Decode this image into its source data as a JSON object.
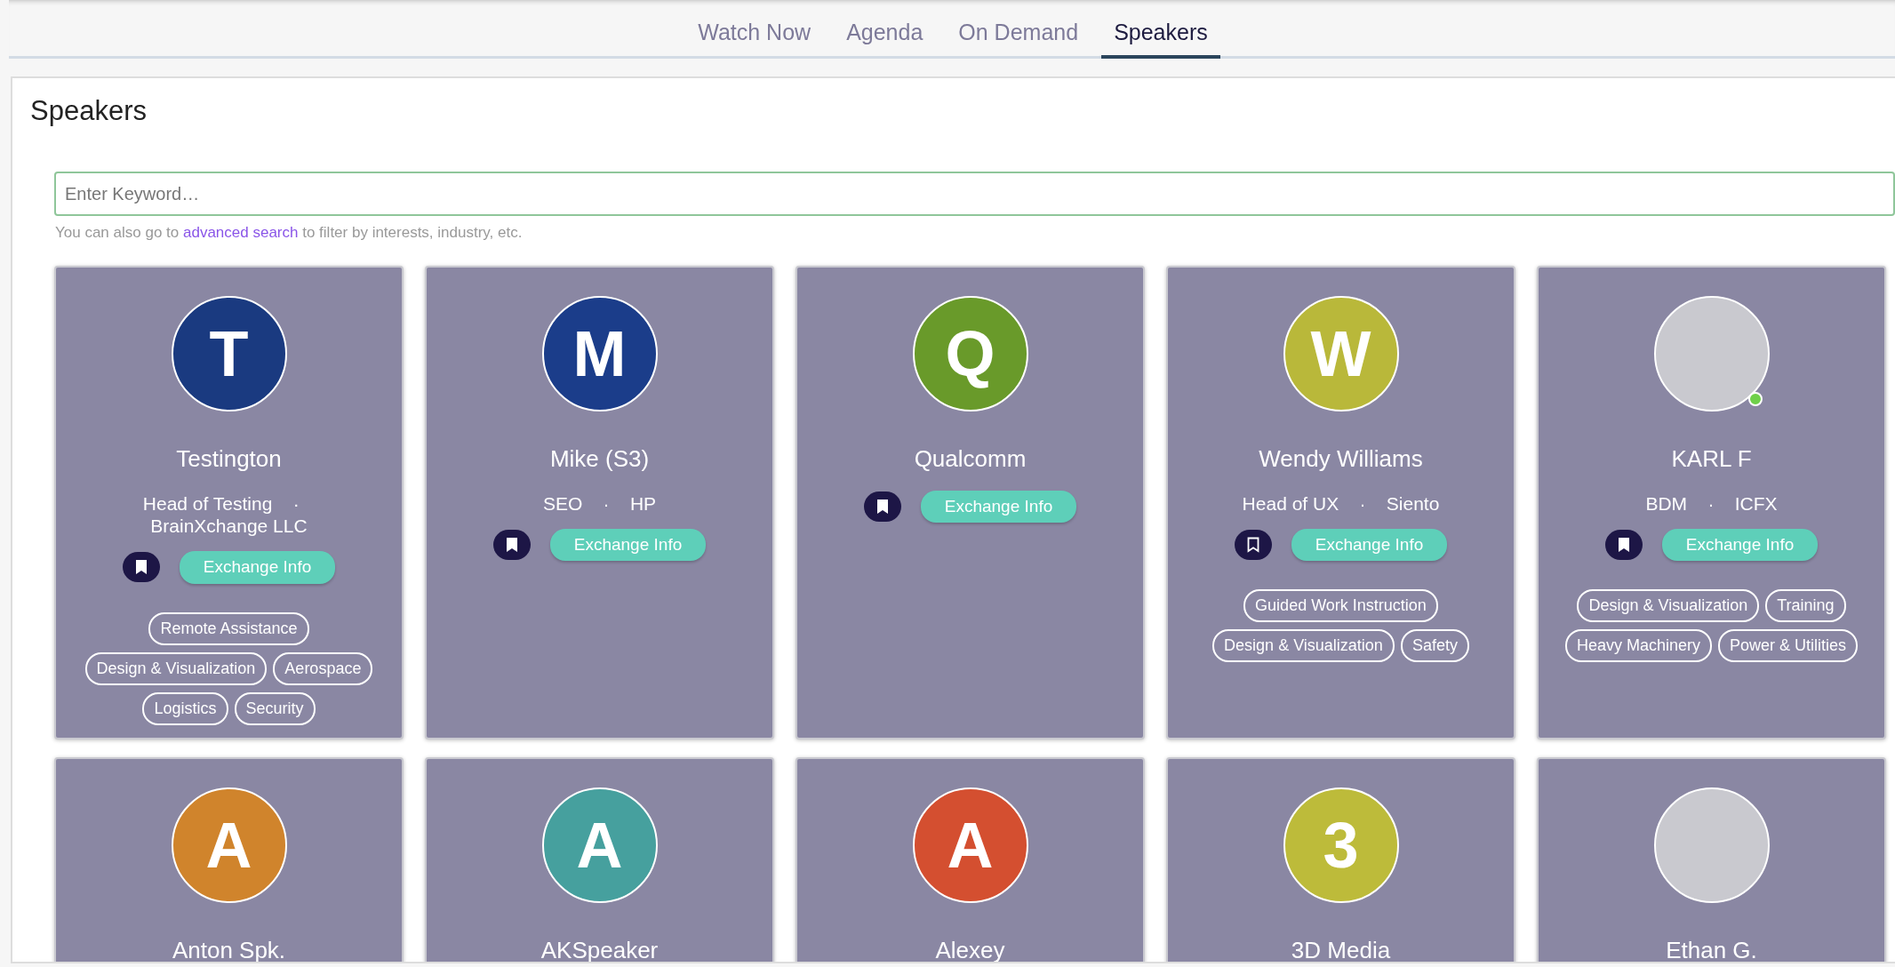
{
  "tabs": [
    {
      "label": "Watch Now",
      "selected": false
    },
    {
      "label": "Agenda",
      "selected": false
    },
    {
      "label": "On Demand",
      "selected": false
    },
    {
      "label": "Speakers",
      "selected": true
    }
  ],
  "panel": {
    "title": "Speakers",
    "search": {
      "placeholder": "Enter Keyword…"
    },
    "hint": {
      "before": "You can also go to",
      "link": "advanced search",
      "after": "to filter by interests, industry, etc."
    }
  },
  "speakers": [
    {
      "kind": "initial",
      "initial": "T",
      "color": "#1a3a80",
      "name": "Testington",
      "title": "Head of Testing",
      "separator": "·",
      "company": "BrainXchange LLC",
      "bookmarked": true,
      "button": "Exchange Info",
      "online": false,
      "tags": [
        "Remote Assistance",
        "Design & Visualization",
        "Aerospace",
        "Logistics",
        "Security"
      ]
    },
    {
      "kind": "initial",
      "initial": "M",
      "color": "#1b3d8a",
      "name": "Mike (S3)",
      "title": "SEO",
      "separator": "·",
      "company": "HP",
      "bookmarked": true,
      "button": "Exchange Info",
      "online": false
    },
    {
      "kind": "initial",
      "initial": "Q",
      "color": "#699a2a",
      "name": "Qualcomm",
      "bookmarked": true,
      "button": "Exchange Info",
      "online": false
    },
    {
      "kind": "initial",
      "initial": "W",
      "color": "#b9b83a",
      "name": "Wendy Williams",
      "title": "Head of UX",
      "separator": "·",
      "company": "Siento",
      "bookmarked": false,
      "button": "Exchange Info",
      "online": false,
      "tags": [
        "Guided Work Instruction",
        "Design & Visualization",
        "Safety"
      ]
    },
    {
      "kind": "photo",
      "name": "KARL F",
      "title": "BDM",
      "separator": "·",
      "company": "ICFX",
      "bookmarked": true,
      "button": "Exchange Info",
      "online": true,
      "tags": [
        "Design & Visualization",
        "Training",
        "Heavy Machinery",
        "Power & Utilities"
      ]
    },
    {
      "kind": "initial",
      "initial": "A",
      "color": "#d0842c",
      "name": "Anton Spk.",
      "online": false
    },
    {
      "kind": "initial",
      "initial": "A",
      "color": "#46a09e",
      "name": "AKSpeaker",
      "online": false
    },
    {
      "kind": "initial",
      "initial": "A",
      "color": "#d44f30",
      "name": "Alexey",
      "online": false
    },
    {
      "kind": "initial",
      "initial": "3",
      "color": "#bdbb3a",
      "name": "3D Media",
      "online": false
    },
    {
      "kind": "photo",
      "name": "Ethan G.",
      "online": false
    }
  ]
}
